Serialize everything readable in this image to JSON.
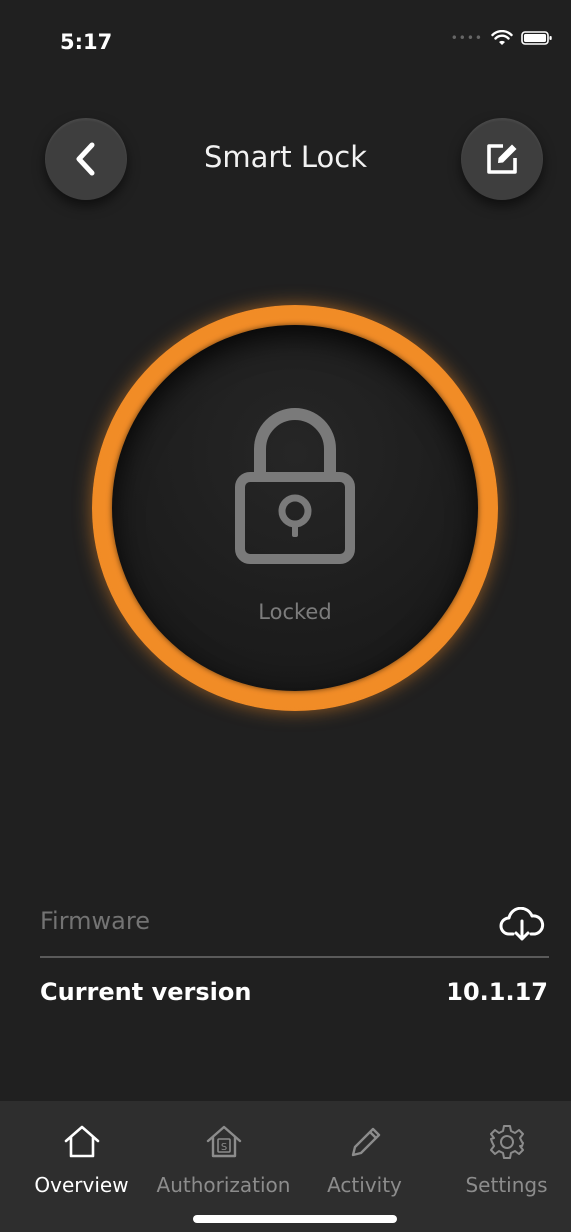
{
  "status": {
    "time": "5:17"
  },
  "header": {
    "title": "Smart Lock"
  },
  "lock": {
    "state_label": "Locked",
    "ring_color": "#f08a24",
    "icon": "padlock-icon"
  },
  "firmware": {
    "section_title": "Firmware",
    "action_icon": "cloud-download-icon",
    "current_version_label": "Current version",
    "current_version_value": "10.1.17"
  },
  "tabs": [
    {
      "label": "Overview",
      "icon": "home-icon",
      "active": true
    },
    {
      "label": "Authorization",
      "icon": "authorization-house-icon",
      "active": false
    },
    {
      "label": "Activity",
      "icon": "pencil-icon",
      "active": false
    },
    {
      "label": "Settings",
      "icon": "gear-icon",
      "active": false
    }
  ],
  "colors": {
    "accent": "#f08a24",
    "background": "#202020",
    "tab_bar": "#2e2e2e"
  }
}
